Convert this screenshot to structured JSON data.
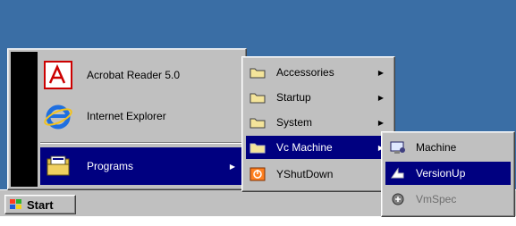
{
  "start_menu": {
    "items": [
      {
        "label": "Acrobat Reader 5.0",
        "icon": "acrobat-icon"
      },
      {
        "label": "Internet Explorer",
        "icon": "internet-explorer-icon"
      },
      {
        "label": "Programs",
        "icon": "programs-icon",
        "selected": true,
        "has_submenu": true
      }
    ]
  },
  "programs_menu": {
    "items": [
      {
        "label": "Accessories",
        "icon": "folder-icon",
        "has_submenu": true
      },
      {
        "label": "Startup",
        "icon": "folder-icon",
        "has_submenu": true
      },
      {
        "label": "System",
        "icon": "folder-icon",
        "has_submenu": true
      },
      {
        "label": "Vc Machine",
        "icon": "folder-icon",
        "selected": true,
        "has_submenu": true
      },
      {
        "label": "YShutDown",
        "icon": "shutdown-icon"
      }
    ]
  },
  "vc_machine_menu": {
    "items": [
      {
        "label": "Machine",
        "icon": "machine-icon"
      },
      {
        "label": "VersionUp",
        "icon": "versionup-icon",
        "selected": true
      },
      {
        "label": "VmSpec",
        "icon": "vmspec-icon",
        "disabled": true
      }
    ]
  },
  "taskbar": {
    "start_label": "Start",
    "start_icon": "windows-logo-icon"
  },
  "colors": {
    "desktop": "#3a6ea5",
    "menu_face": "#c0c0c0",
    "highlight": "#000080",
    "menu_band": "#000000"
  }
}
